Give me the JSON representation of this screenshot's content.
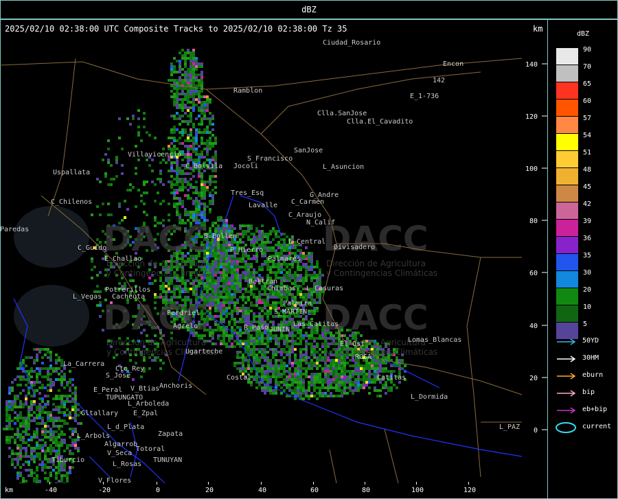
{
  "window": {
    "title": "dBZ"
  },
  "header": {
    "text": "2025/02/10 02:38:00 UTC Composite Tracks to 2025/02/10 02:38:00 Tz 35",
    "km_label": "km"
  },
  "legend": {
    "title": "dBZ",
    "levels": [
      {
        "value": "90",
        "color": "#e8e8e8"
      },
      {
        "value": "70",
        "color": "#c0c0c0"
      },
      {
        "value": "65",
        "color": "#ff3322"
      },
      {
        "value": "60",
        "color": "#ff5500"
      },
      {
        "value": "57",
        "color": "#ff8844"
      },
      {
        "value": "54",
        "color": "#ffff00"
      },
      {
        "value": "51",
        "color": "#ffcc33"
      },
      {
        "value": "48",
        "color": "#f0b030"
      },
      {
        "value": "45",
        "color": "#cc8844"
      },
      {
        "value": "42",
        "color": "#cc6699"
      },
      {
        "value": "39",
        "color": "#cc2299"
      },
      {
        "value": "36",
        "color": "#8822cc"
      },
      {
        "value": "35",
        "color": "#2255ee"
      },
      {
        "value": "30",
        "color": "#1188dd"
      },
      {
        "value": "20",
        "color": "#118811"
      },
      {
        "value": "10",
        "color": "#116611"
      },
      {
        "value": "5",
        "color": "#554499"
      }
    ],
    "tracks": [
      {
        "label": "50YD",
        "color": "#33bbdd",
        "icon": "arrow-icon"
      },
      {
        "label": "30HM",
        "color": "#ffffff",
        "icon": "arrow-icon"
      },
      {
        "label": "eburn",
        "color": "#ffaa22",
        "icon": "arrow-icon"
      },
      {
        "label": "bip",
        "color": "#ffaacc",
        "icon": "arrow-icon"
      },
      {
        "label": "eb+bip",
        "color": "#cc33cc",
        "icon": "arrow-icon"
      },
      {
        "label": "current",
        "color": "#33ddee",
        "icon": "ellipse-icon"
      }
    ]
  },
  "axes": {
    "x_unit": "km",
    "x_ticks": [
      "-40",
      "-20",
      "0",
      "20",
      "40",
      "60",
      "80",
      "100",
      "120"
    ],
    "y_ticks": [
      "140",
      "120",
      "100",
      "80",
      "60",
      "40",
      "20",
      "0"
    ]
  },
  "watermark": {
    "text": "DACC",
    "line1": "Dirección de Agricultura",
    "line2": "y Contingencias Climáticas"
  },
  "places": [
    {
      "name": "Ciudad_Rosario"
    },
    {
      "name": "Encon"
    },
    {
      "name": "142"
    },
    {
      "name": "E_1-736"
    },
    {
      "name": "Ramblon"
    },
    {
      "name": "Clla.SanJose"
    },
    {
      "name": "Clla.El_Cavadito"
    },
    {
      "name": "Villavicencio"
    },
    {
      "name": "S_Francisco"
    },
    {
      "name": "SanJose"
    },
    {
      "name": "C_Bolvila"
    },
    {
      "name": "Jocoli"
    },
    {
      "name": "L_Asuncion"
    },
    {
      "name": "Uspallata"
    },
    {
      "name": "Tres_Esq"
    },
    {
      "name": "G_Andre"
    },
    {
      "name": "C_Chilenos"
    },
    {
      "name": "Lavalle"
    },
    {
      "name": "C_Carmen"
    },
    {
      "name": "C_Araujo"
    },
    {
      "name": "N_Calif"
    },
    {
      "name": "Paredas"
    },
    {
      "name": "B_Bollen"
    },
    {
      "name": "L_Central"
    },
    {
      "name": "C_Guido"
    },
    {
      "name": "P_Hierro"
    },
    {
      "name": "Divisadero"
    },
    {
      "name": "E_Challao"
    },
    {
      "name": "Palmares"
    },
    {
      "name": "Potrerillos"
    },
    {
      "name": "Beltran"
    },
    {
      "name": "Chimbas"
    },
    {
      "name": "L_Casuras"
    },
    {
      "name": "L_Vegas"
    },
    {
      "name": "Cacheuta"
    },
    {
      "name": "S_MARTIN"
    },
    {
      "name": "Perdriel"
    },
    {
      "name": "Palmira"
    },
    {
      "name": "Agrelo"
    },
    {
      "name": "R_Paso"
    },
    {
      "name": "JUNIN"
    },
    {
      "name": "Las_Catitas"
    },
    {
      "name": "Lomas_Blancas"
    },
    {
      "name": "Ugarteche"
    },
    {
      "name": "El_Ost"
    },
    {
      "name": "La_Carrera"
    },
    {
      "name": "Cto_Rey"
    },
    {
      "name": "ROSA"
    },
    {
      "name": "S_Jose"
    },
    {
      "name": "Costal"
    },
    {
      "name": "Catitas"
    },
    {
      "name": "E_Peral"
    },
    {
      "name": "V_Btias"
    },
    {
      "name": "Anchoris"
    },
    {
      "name": "TUPUNGATO"
    },
    {
      "name": "L_Dormida"
    },
    {
      "name": "L_Arboleda"
    },
    {
      "name": "Gltallary"
    },
    {
      "name": "E_Zpal"
    },
    {
      "name": "L_d_Plata"
    },
    {
      "name": "L_Arbols"
    },
    {
      "name": "Zapata"
    },
    {
      "name": "L_PAZ"
    },
    {
      "name": "Algarrob"
    },
    {
      "name": "TUNUYAN"
    },
    {
      "name": "V_Seca"
    },
    {
      "name": "Totoral"
    },
    {
      "name": "L_Rosas"
    },
    {
      "name": "V_Flores"
    },
    {
      "name": "Tiburcio"
    }
  ]
}
